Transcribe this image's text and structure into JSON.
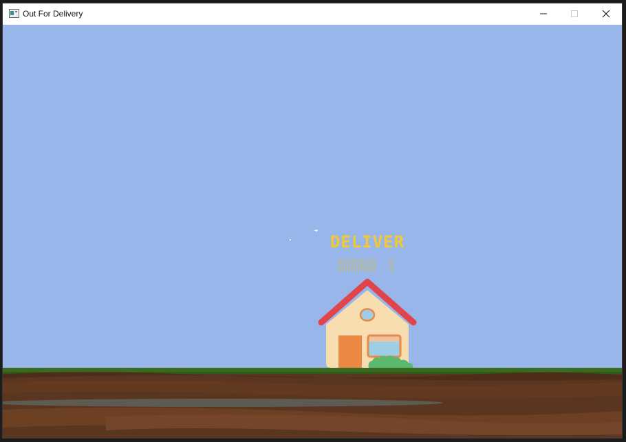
{
  "window": {
    "title": "Out For Delivery",
    "controls": {
      "minimize": "minimize",
      "maximize": "maximize",
      "close": "close"
    }
  },
  "game": {
    "prompt_line1": "DELIVER",
    "prompt_line2": "HERE !",
    "colors": {
      "sky": "#98b6ea",
      "grass": "#3a6a1f",
      "dirt": "#5a3620",
      "puddle": "#5d5b52",
      "prompt": "#f2c934",
      "roof": "#e0454b",
      "house_wall": "#f8ddb0",
      "door": "#eb8843",
      "window_glass": "#9ccfe7",
      "bush": "#5bb86f"
    },
    "icons": {
      "app": "app-window-icon",
      "minimize": "minimize-icon",
      "maximize": "maximize-icon",
      "close": "close-icon"
    }
  }
}
